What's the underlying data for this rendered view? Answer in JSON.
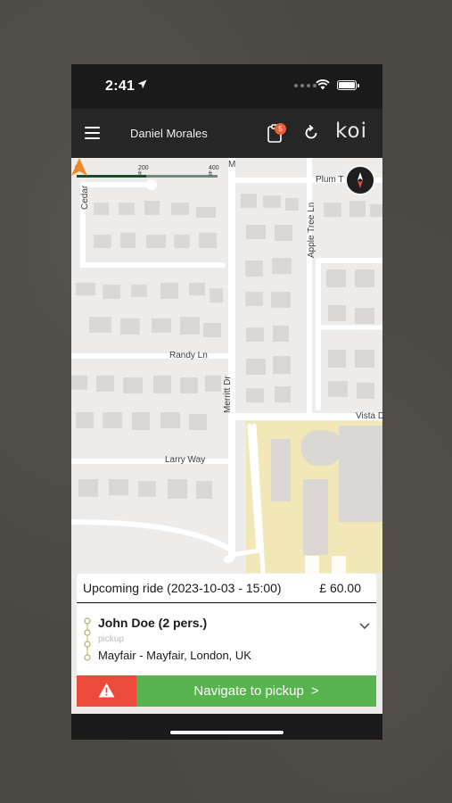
{
  "status_bar": {
    "time": "2:41",
    "icons": [
      "location-arrow-icon",
      "signal-dots-icon",
      "wifi-icon",
      "battery-icon"
    ]
  },
  "header": {
    "driver_name": "Daniel Morales",
    "notification_count": "5",
    "logo": "koi",
    "icons": [
      "hamburger-menu-icon",
      "clipboard-icon",
      "refresh-icon"
    ]
  },
  "map": {
    "scale": {
      "zero": "0",
      "mid": "200 ft",
      "max": "400 ft"
    },
    "streets": {
      "cedar": "Cedar",
      "m_partial": "M",
      "plum": "Plum T",
      "apple_tree": "Apple Tree Ln",
      "randy": "Randy Ln",
      "merritt": "Merritt Dr",
      "vista": "Vista D",
      "larry": "Larry Way"
    },
    "colors": {
      "background": "#eeeceb",
      "road": "#ffffff",
      "building": "#dad8d4",
      "campus": "#f2e7b6",
      "nav_marker": "#ee8a2a"
    }
  },
  "ride": {
    "title": "Upcoming ride (2023-10-03 - 15:00)",
    "price": "£ 60.00",
    "passenger": "John Doe (2 pers.)",
    "stop_type": "pickup",
    "address": "Mayfair - Mayfair, London, UK",
    "navigate_label": "Navigate to pickup",
    "navigate_arrow": ">",
    "colors": {
      "alert": "#ed4a3c",
      "navigate": "#57b44e"
    }
  }
}
